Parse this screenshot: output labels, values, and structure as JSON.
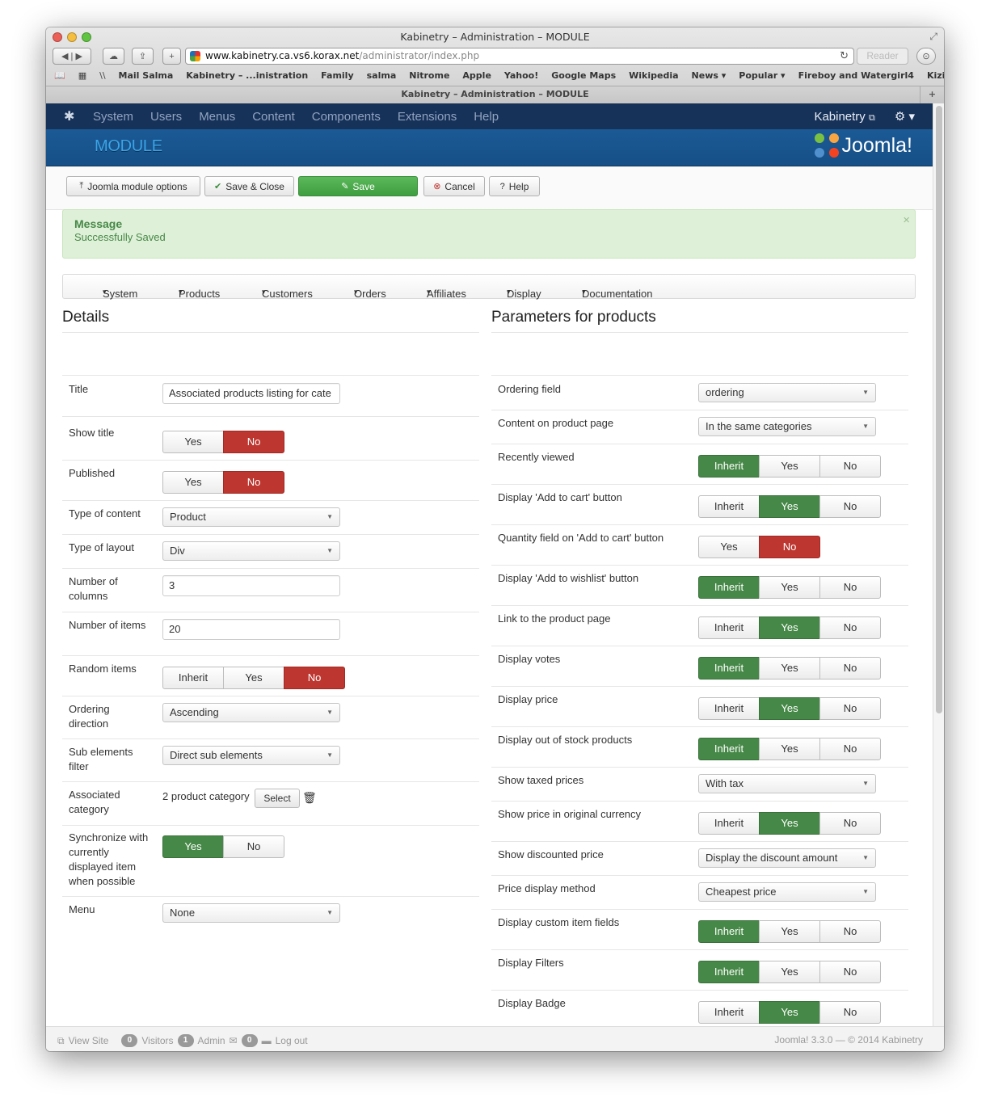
{
  "browser": {
    "window_title": "Kabinetry – Administration – MODULE",
    "url_host": "www.kabinetry.ca.vs6.korax.net",
    "url_path": "/administrator/index.php",
    "reader_label": "Reader",
    "bookmarks": [
      "Mail Salma",
      "Kabinetry – ...inistration",
      "Family",
      "salma",
      "Nitrome",
      "Apple",
      "Yahoo!",
      "Google Maps",
      "Wikipedia",
      "News ▾",
      "Popular ▾",
      "Fireboy and Watergirl4",
      "Kizi"
    ],
    "tab_title": "Kabinetry – Administration – MODULE"
  },
  "navbar": {
    "items": [
      "System",
      "Users",
      "Menus",
      "Content",
      "Components",
      "Extensions",
      "Help"
    ],
    "site_name": "Kabinetry"
  },
  "header": {
    "title": "MODULE",
    "brand": "Joomla!"
  },
  "toolbar": {
    "options": "Joomla module options",
    "save_close": "Save & Close",
    "save": "Save",
    "cancel": "Cancel",
    "help": "Help"
  },
  "message": {
    "heading": "Message",
    "text": "Successfully Saved",
    "close": "×"
  },
  "submenu": [
    "System",
    "Products",
    "Customers",
    "Orders",
    "Affiliates",
    "Display",
    "Documentation"
  ],
  "details": {
    "heading": "Details",
    "title_label": "Title",
    "title_value": "Associated products listing for cate",
    "show_title_label": "Show title",
    "published_label": "Published",
    "type_content_label": "Type of content",
    "type_content_value": "Product",
    "type_layout_label": "Type of layout",
    "type_layout_value": "Div",
    "columns_label_1": "Number of",
    "columns_label_2": "columns",
    "columns_value": "3",
    "items_label": "Number of items",
    "items_value": "20",
    "random_label": "Random items",
    "ordering_dir_label_1": "Ordering",
    "ordering_dir_label_2": "direction",
    "ordering_dir_value": "Ascending",
    "sub_label_1": "Sub elements",
    "sub_label_2": "filter",
    "sub_value": "Direct sub elements",
    "assoc_label_1": "Associated",
    "assoc_label_2": "category",
    "assoc_value": "2 product category",
    "select_button": "Select",
    "sync_label_1": "Synchronize with",
    "sync_label_2": "currently",
    "sync_label_3": "displayed item",
    "sync_label_4": "when possible",
    "menu_label": "Menu",
    "menu_value": "None"
  },
  "toggle": {
    "inherit": "Inherit",
    "yes": "Yes",
    "no": "No"
  },
  "params": {
    "heading": "Parameters for products",
    "ordering_field_label": "Ordering field",
    "ordering_field_value": "ordering",
    "content_label": "Content on product page",
    "content_value": "In the same categories",
    "recently_label": "Recently viewed",
    "add_cart_label": "Display 'Add to cart' button",
    "qty_label": "Quantity field on 'Add to cart' button",
    "wishlist_label": "Display 'Add to wishlist' button",
    "link_label": "Link to the product page",
    "votes_label": "Display votes",
    "price_label": "Display price",
    "out_stock_label": "Display out of stock products",
    "taxed_label": "Show taxed prices",
    "taxed_value": "With tax",
    "orig_currency_label": "Show price in original currency",
    "discounted_label": "Show discounted price",
    "discounted_value": "Display the discount amount",
    "price_method_label": "Price display method",
    "price_method_value": "Cheapest price",
    "custom_fields_label": "Display custom item fields",
    "filters_label": "Display Filters",
    "badge_label": "Display Badge"
  },
  "footer": {
    "view_site": "View Site",
    "visitors_count": "0",
    "visitors": "Visitors",
    "admin_count": "1",
    "admin": "Admin",
    "messages_count": "0",
    "logout": "Log out",
    "version": "Joomla! 3.3.0  —  © 2014 Kabinetry"
  },
  "colors": {
    "navbar": "#173259",
    "header": "#1b5a96",
    "success": "#468847",
    "danger": "#bd362f"
  }
}
